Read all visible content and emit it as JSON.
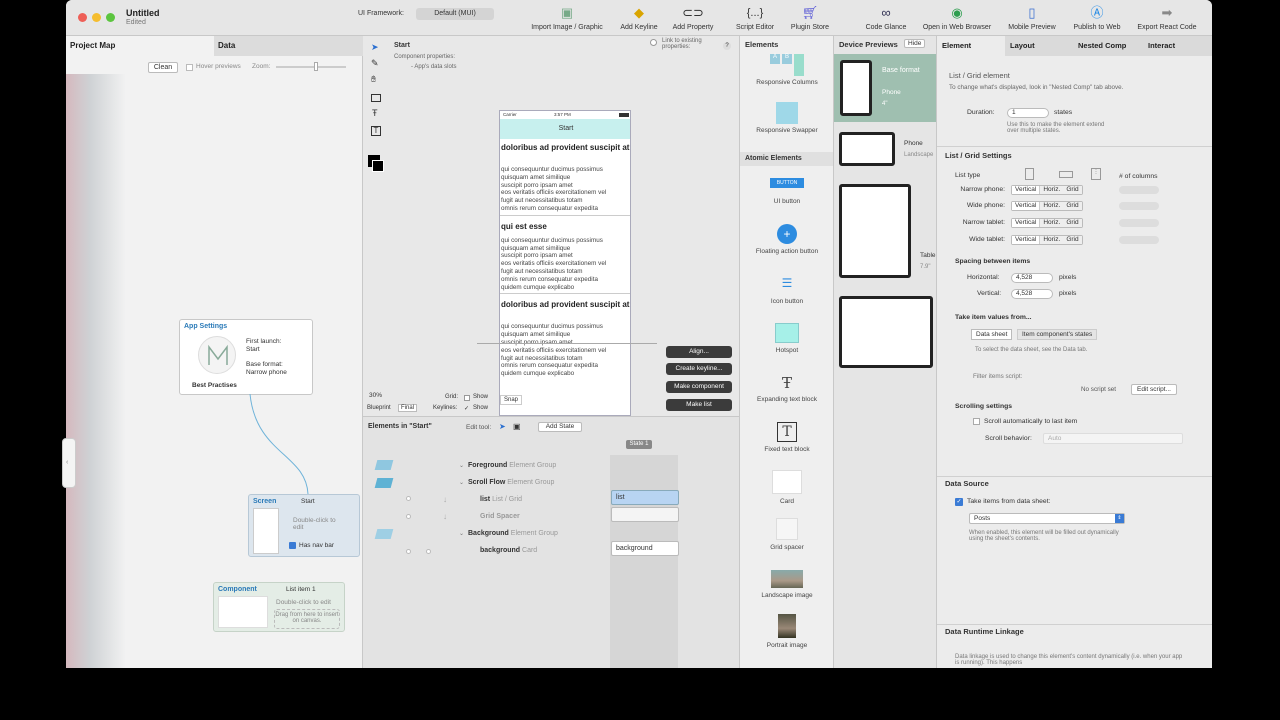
{
  "window": {
    "title": "Untitled",
    "subtitle": "Edited",
    "ui_framework_label": "UI Framework:",
    "ui_framework_value": "Default (MUI)"
  },
  "toolbar": {
    "buttons": [
      {
        "label": "Import Image / Graphic",
        "icon": "image-icon"
      },
      {
        "label": "Add Keyline",
        "icon": "keyline-icon"
      },
      {
        "label": "Add Property",
        "icon": "link-icon"
      },
      {
        "label": "Script Editor",
        "icon": "braces-icon"
      },
      {
        "label": "Plugin Store",
        "icon": "cart-icon"
      },
      {
        "label": "Code Glance",
        "icon": "binoculars-icon"
      },
      {
        "label": "Open in Web Browser",
        "icon": "browser-icon"
      },
      {
        "label": "Mobile Preview",
        "icon": "phone-icon"
      },
      {
        "label": "Publish to Web",
        "icon": "publish-icon"
      },
      {
        "label": "Export React Code",
        "icon": "export-icon"
      }
    ]
  },
  "left": {
    "tabs": [
      "Project Map",
      "Data"
    ],
    "clean_label": "Clean",
    "hover_previews": "Hover previews",
    "zoom_label": "Zoom:",
    "app_settings": {
      "title": "App Settings",
      "first_launch": "First launch:",
      "first_launch_value": "Start",
      "base_format": "Base format:",
      "base_format_value": "Narrow phone",
      "best_practises": "Best Practises"
    },
    "screen_node": {
      "title": "Screen",
      "name": "Start",
      "hint": "Double-click to edit",
      "nav_bar": "Has nav bar"
    },
    "component_node": {
      "title": "Component",
      "name": "List item 1",
      "hint": "Double-click to edit",
      "drag_hint": "Drag from here to insert on canvas."
    }
  },
  "canvas": {
    "screen_name": "Start",
    "component_props": "Component properties:",
    "app_data_slots": "- App's data slots",
    "link_existing": "Link to existing properties:",
    "carrier": "Carrier",
    "time": "3:57 PM",
    "nav_title": "Start",
    "heading1": "doloribus ad provident suscipit at",
    "body1": [
      "qui consequuntur ducimus possimus",
      "quisquam amet similique",
      "suscipit porro ipsam amet",
      "eos veritatis officiis exercitationem vel",
      "fugit aut necessitatibus totam",
      "omnis rerum consequatur expedita",
      "quidem cumque explicabo"
    ],
    "heading2": "qui est esse",
    "body2": [
      "qui consequuntur ducimus possimus",
      "quisquam amet similique",
      "suscipit porro ipsam amet",
      "eos veritatis officiis exercitationem vel",
      "fugit aut necessitatibus totam",
      "omnis rerum consequatur expedita",
      "quidem cumque explicabo"
    ],
    "heading3": "doloribus ad provident suscipit at",
    "body3": [
      "qui consequuntur ducimus possimus",
      "quisquam amet similique",
      "suscipit porro ipsam amet",
      "eos veritatis officiis exercitationem vel",
      "fugit aut necessitatibus totam",
      "omnis rerum consequatur expedita",
      "quidem cumque explicabo"
    ],
    "zoom_pct": "30%",
    "blueprint": "Blueprint",
    "final": "Final",
    "grid_label": "Grid:",
    "grid_show": "Show",
    "keylines_label": "Keylines:",
    "keylines_show": "Show",
    "snap_label": "Snap",
    "align_btn": "Align...",
    "create_keyline_btn": "Create keyline...",
    "make_component_btn": "Make component",
    "make_list_btn": "Make list"
  },
  "elements_panel": {
    "title": "Elements in \"Start\"",
    "edit_tool": "Edit tool:",
    "add_state": "Add State",
    "state1": "State 1",
    "rows": [
      {
        "name": "Foreground",
        "type": "Element Group"
      },
      {
        "name": "Scroll Flow",
        "type": "Element Group"
      },
      {
        "name": "list",
        "type": "List / Grid"
      },
      {
        "name": "Grid Spacer",
        "type": ""
      },
      {
        "name": "Background",
        "type": "Element Group"
      },
      {
        "name": "background",
        "type": "Card"
      }
    ],
    "cell_list": "list",
    "cell_background": "background"
  },
  "palette": {
    "header": "Elements",
    "atomic_header": "Atomic Elements",
    "items_top": [
      "Responsive Columns",
      "Responsive Swapper"
    ],
    "items": [
      "UI button",
      "Floating action button",
      "Icon button",
      "Hotspot",
      "Expanding text block",
      "Fixed text block",
      "Card",
      "Grid spacer",
      "Landscape image",
      "Portrait image"
    ],
    "ui_button_text": "BUTTON"
  },
  "devices": {
    "header": "Device Previews",
    "hide": "Hide",
    "base_format": "Base format",
    "phone1": "Phone",
    "phone1_size": "4\"",
    "phone2": "Phone",
    "phone2_sub": "Landscape",
    "tablet": "Table",
    "tablet_size": "7.9\""
  },
  "inspector": {
    "tabs": [
      "Element",
      "Layout",
      "Nested Comp",
      "Interact"
    ],
    "element_type": "List / Grid element",
    "element_hint": "To change what's displayed, look in \"Nested Comp\" tab above.",
    "duration_label": "Duration:",
    "duration_value": "1",
    "duration_unit": "states",
    "duration_hint": "Use this to make the element extend over multiple states.",
    "list_grid_settings": "List / Grid Settings",
    "list_type": "List type",
    "num_columns": "# of columns",
    "device_rows": [
      {
        "label": "Narrow phone:"
      },
      {
        "label": "Wide phone:"
      },
      {
        "label": "Narrow tablet:"
      },
      {
        "label": "Wide tablet:"
      }
    ],
    "seg_vertical": "Vertical",
    "seg_horiz": "Horiz.",
    "seg_grid": "Grid",
    "spacing_title": "Spacing between items",
    "horizontal_label": "Horizontal:",
    "vertical_label": "Vertical:",
    "spacing_value": "4,528",
    "pixels": "pixels",
    "take_values": "Take item values from...",
    "data_sheet_btn": "Data sheet",
    "comp_states_btn": "Item component's states",
    "data_tab_hint": "To select the data sheet, see the Data tab.",
    "filter_script": "Filter items script:",
    "no_script": "No script set",
    "edit_script": "Edit script...",
    "scrolling_settings": "Scrolling settings",
    "scroll_auto": "Scroll automatically to last item",
    "scroll_behavior": "Scroll behavior:",
    "scroll_behavior_value": "Auto",
    "data_source": "Data Source",
    "take_items": "Take items from data sheet:",
    "sheet_value": "Posts",
    "data_source_hint": "When enabled, this element will be filled out dynamically using the sheet's contents.",
    "runtime_linkage": "Data Runtime Linkage",
    "runtime_hint": "Data linkage is used to change this element's content dynamically (i.e. when your app is running). This happens"
  }
}
